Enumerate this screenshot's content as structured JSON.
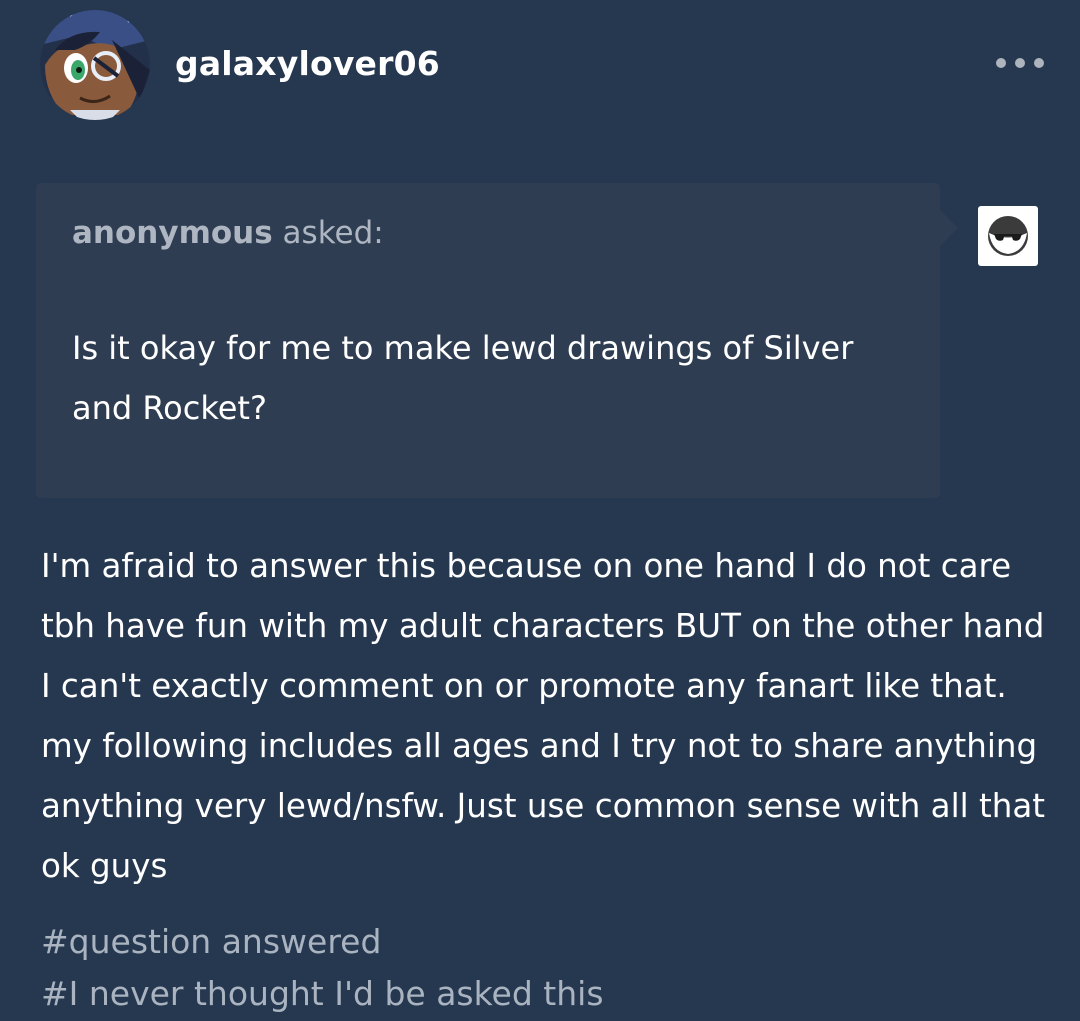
{
  "post": {
    "author": {
      "username": "galaxylover06"
    },
    "menu_icon": "more-horizontal-icon",
    "ask": {
      "asker_name": "anonymous",
      "asked_label": "asked:",
      "question": "Is it okay for me to make lewd drawings of Silver and Rocket?",
      "asker_avatar_icon": "anonymous-sunglasses-icon"
    },
    "answer": "I'm afraid to answer this because on one hand I do not care tbh have fun with my adult characters BUT on the other hand I can't exactly comment on or promote any fanart like that. my following includes all ages and I try not to share anything anything very lewd/nsfw. Just use common sense with all that ok guys",
    "tags": [
      "#question answered",
      "#I never thought I'd be asked this"
    ]
  },
  "colors": {
    "background": "#263850",
    "ask_box": "#2f3d52",
    "text": "#ffffff",
    "muted_text": "#aab3c0"
  }
}
